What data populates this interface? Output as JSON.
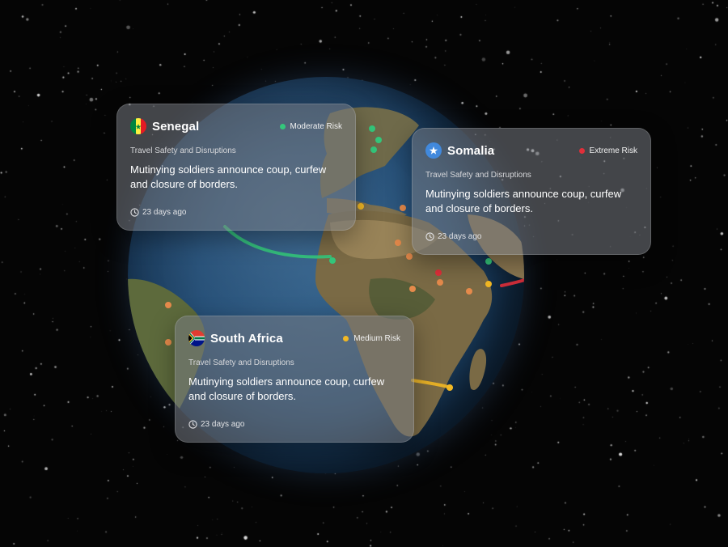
{
  "cards": [
    {
      "country": "Senegal",
      "flag_icon": "senegal-flag-icon",
      "risk": "Moderate Risk",
      "risk_color": "#34c77b",
      "category": "Travel Safety and Disruptions",
      "headline": "Mutinying soldiers announce coup, curfew and closure of borders.",
      "time": "23 days ago"
    },
    {
      "country": "Somalia",
      "flag_icon": "somalia-flag-icon",
      "risk": "Extreme Risk",
      "risk_color": "#e02f3a",
      "category": "Travel Safety and Disruptions",
      "headline": "Mutinying soldiers announce coup, curfew and closure of borders.",
      "time": "23 days ago"
    },
    {
      "country": "South Africa",
      "flag_icon": "south-africa-flag-icon",
      "risk": "Medium Risk",
      "risk_color": "#f2b824",
      "category": "Travel Safety and Disruptions",
      "headline": "Mutinying soldiers announce coup, curfew and closure of borders.",
      "time": "23 days ago"
    }
  ],
  "colors": {
    "space": "#050505",
    "ocean": "#1f4a73",
    "land": "#7a6a45",
    "moderate": "#34c77b",
    "extreme": "#e02f3a",
    "medium": "#f2b824",
    "hotspot": "#e58a4b"
  }
}
